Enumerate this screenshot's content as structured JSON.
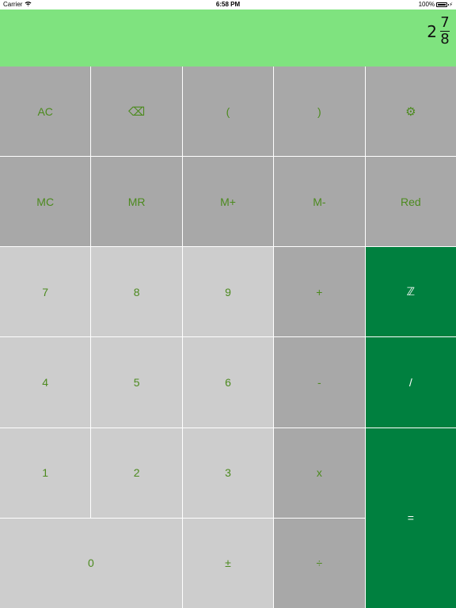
{
  "status": {
    "carrier": "Carrier",
    "time": "6:58 PM",
    "battery": "100%"
  },
  "display": {
    "whole": "2",
    "numerator": "7",
    "denominator": "8"
  },
  "keys": {
    "ac": "AC",
    "backspace": "⌫",
    "lparen": "(",
    "rparen": ")",
    "settings": "⚙",
    "mc": "MC",
    "mr": "MR",
    "mplus": "M+",
    "mminus": "M-",
    "red": "Red",
    "seven": "7",
    "eight": "8",
    "nine": "9",
    "plus": "+",
    "integer": "ℤ",
    "four": "4",
    "five": "5",
    "six": "6",
    "minus": "-",
    "fraction": "/",
    "one": "1",
    "two": "2",
    "three": "3",
    "times": "x",
    "equals": "=",
    "zero": "0",
    "plusminus": "±",
    "divide": "÷"
  },
  "colors": {
    "display_bg": "#7fe37f",
    "key_dark": "#a8a8a8",
    "key_light": "#cdcdcd",
    "key_green": "#00803f",
    "key_text": "#4c8a1e"
  }
}
